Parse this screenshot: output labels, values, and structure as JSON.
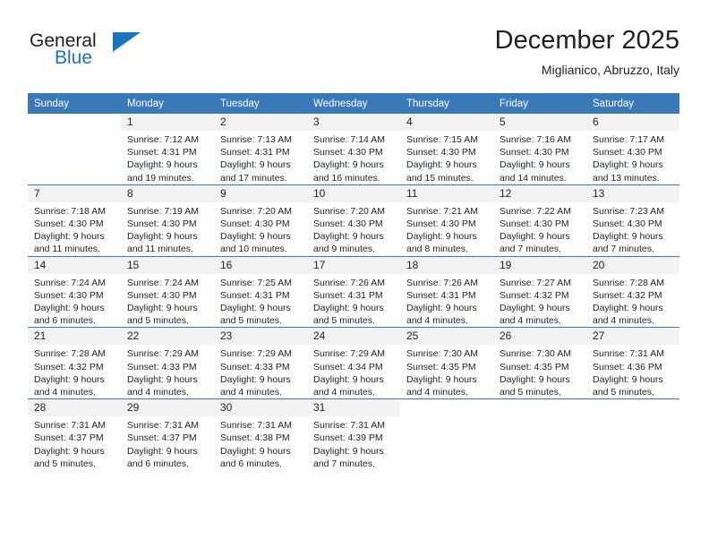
{
  "brand": {
    "name_top": "General",
    "name_bottom": "Blue",
    "triangle_icon": "triangle-icon",
    "color_dark": "#231f20",
    "color_blue": "#1b75bc"
  },
  "header": {
    "title": "December 2025",
    "subtitle": "Miglianico, Abruzzo, Italy"
  },
  "theme": {
    "header_bar": "#3a79b8",
    "daynum_bg": "#f2f2f2",
    "text": "#231f20"
  },
  "weekdays": [
    "Sunday",
    "Monday",
    "Tuesday",
    "Wednesday",
    "Thursday",
    "Friday",
    "Saturday"
  ],
  "weeks": [
    [
      {
        "day": "",
        "lines": [
          "",
          "",
          "",
          ""
        ]
      },
      {
        "day": "1",
        "lines": [
          "Sunrise: 7:12 AM",
          "Sunset: 4:31 PM",
          "Daylight: 9 hours",
          "and 19 minutes."
        ]
      },
      {
        "day": "2",
        "lines": [
          "Sunrise: 7:13 AM",
          "Sunset: 4:31 PM",
          "Daylight: 9 hours",
          "and 17 minutes."
        ]
      },
      {
        "day": "3",
        "lines": [
          "Sunrise: 7:14 AM",
          "Sunset: 4:30 PM",
          "Daylight: 9 hours",
          "and 16 minutes."
        ]
      },
      {
        "day": "4",
        "lines": [
          "Sunrise: 7:15 AM",
          "Sunset: 4:30 PM",
          "Daylight: 9 hours",
          "and 15 minutes."
        ]
      },
      {
        "day": "5",
        "lines": [
          "Sunrise: 7:16 AM",
          "Sunset: 4:30 PM",
          "Daylight: 9 hours",
          "and 14 minutes."
        ]
      },
      {
        "day": "6",
        "lines": [
          "Sunrise: 7:17 AM",
          "Sunset: 4:30 PM",
          "Daylight: 9 hours",
          "and 13 minutes."
        ]
      }
    ],
    [
      {
        "day": "7",
        "lines": [
          "Sunrise: 7:18 AM",
          "Sunset: 4:30 PM",
          "Daylight: 9 hours",
          "and 11 minutes."
        ]
      },
      {
        "day": "8",
        "lines": [
          "Sunrise: 7:19 AM",
          "Sunset: 4:30 PM",
          "Daylight: 9 hours",
          "and 11 minutes."
        ]
      },
      {
        "day": "9",
        "lines": [
          "Sunrise: 7:20 AM",
          "Sunset: 4:30 PM",
          "Daylight: 9 hours",
          "and 10 minutes."
        ]
      },
      {
        "day": "10",
        "lines": [
          "Sunrise: 7:20 AM",
          "Sunset: 4:30 PM",
          "Daylight: 9 hours",
          "and 9 minutes."
        ]
      },
      {
        "day": "11",
        "lines": [
          "Sunrise: 7:21 AM",
          "Sunset: 4:30 PM",
          "Daylight: 9 hours",
          "and 8 minutes."
        ]
      },
      {
        "day": "12",
        "lines": [
          "Sunrise: 7:22 AM",
          "Sunset: 4:30 PM",
          "Daylight: 9 hours",
          "and 7 minutes."
        ]
      },
      {
        "day": "13",
        "lines": [
          "Sunrise: 7:23 AM",
          "Sunset: 4:30 PM",
          "Daylight: 9 hours",
          "and 7 minutes."
        ]
      }
    ],
    [
      {
        "day": "14",
        "lines": [
          "Sunrise: 7:24 AM",
          "Sunset: 4:30 PM",
          "Daylight: 9 hours",
          "and 6 minutes."
        ]
      },
      {
        "day": "15",
        "lines": [
          "Sunrise: 7:24 AM",
          "Sunset: 4:30 PM",
          "Daylight: 9 hours",
          "and 5 minutes."
        ]
      },
      {
        "day": "16",
        "lines": [
          "Sunrise: 7:25 AM",
          "Sunset: 4:31 PM",
          "Daylight: 9 hours",
          "and 5 minutes."
        ]
      },
      {
        "day": "17",
        "lines": [
          "Sunrise: 7:26 AM",
          "Sunset: 4:31 PM",
          "Daylight: 9 hours",
          "and 5 minutes."
        ]
      },
      {
        "day": "18",
        "lines": [
          "Sunrise: 7:26 AM",
          "Sunset: 4:31 PM",
          "Daylight: 9 hours",
          "and 4 minutes."
        ]
      },
      {
        "day": "19",
        "lines": [
          "Sunrise: 7:27 AM",
          "Sunset: 4:32 PM",
          "Daylight: 9 hours",
          "and 4 minutes."
        ]
      },
      {
        "day": "20",
        "lines": [
          "Sunrise: 7:28 AM",
          "Sunset: 4:32 PM",
          "Daylight: 9 hours",
          "and 4 minutes."
        ]
      }
    ],
    [
      {
        "day": "21",
        "lines": [
          "Sunrise: 7:28 AM",
          "Sunset: 4:32 PM",
          "Daylight: 9 hours",
          "and 4 minutes."
        ]
      },
      {
        "day": "22",
        "lines": [
          "Sunrise: 7:29 AM",
          "Sunset: 4:33 PM",
          "Daylight: 9 hours",
          "and 4 minutes."
        ]
      },
      {
        "day": "23",
        "lines": [
          "Sunrise: 7:29 AM",
          "Sunset: 4:33 PM",
          "Daylight: 9 hours",
          "and 4 minutes."
        ]
      },
      {
        "day": "24",
        "lines": [
          "Sunrise: 7:29 AM",
          "Sunset: 4:34 PM",
          "Daylight: 9 hours",
          "and 4 minutes."
        ]
      },
      {
        "day": "25",
        "lines": [
          "Sunrise: 7:30 AM",
          "Sunset: 4:35 PM",
          "Daylight: 9 hours",
          "and 4 minutes."
        ]
      },
      {
        "day": "26",
        "lines": [
          "Sunrise: 7:30 AM",
          "Sunset: 4:35 PM",
          "Daylight: 9 hours",
          "and 5 minutes."
        ]
      },
      {
        "day": "27",
        "lines": [
          "Sunrise: 7:31 AM",
          "Sunset: 4:36 PM",
          "Daylight: 9 hours",
          "and 5 minutes."
        ]
      }
    ],
    [
      {
        "day": "28",
        "lines": [
          "Sunrise: 7:31 AM",
          "Sunset: 4:37 PM",
          "Daylight: 9 hours",
          "and 5 minutes."
        ]
      },
      {
        "day": "29",
        "lines": [
          "Sunrise: 7:31 AM",
          "Sunset: 4:37 PM",
          "Daylight: 9 hours",
          "and 6 minutes."
        ]
      },
      {
        "day": "30",
        "lines": [
          "Sunrise: 7:31 AM",
          "Sunset: 4:38 PM",
          "Daylight: 9 hours",
          "and 6 minutes."
        ]
      },
      {
        "day": "31",
        "lines": [
          "Sunrise: 7:31 AM",
          "Sunset: 4:39 PM",
          "Daylight: 9 hours",
          "and 7 minutes."
        ]
      },
      {
        "day": "",
        "lines": [
          "",
          "",
          "",
          ""
        ]
      },
      {
        "day": "",
        "lines": [
          "",
          "",
          "",
          ""
        ]
      },
      {
        "day": "",
        "lines": [
          "",
          "",
          "",
          ""
        ]
      }
    ]
  ]
}
